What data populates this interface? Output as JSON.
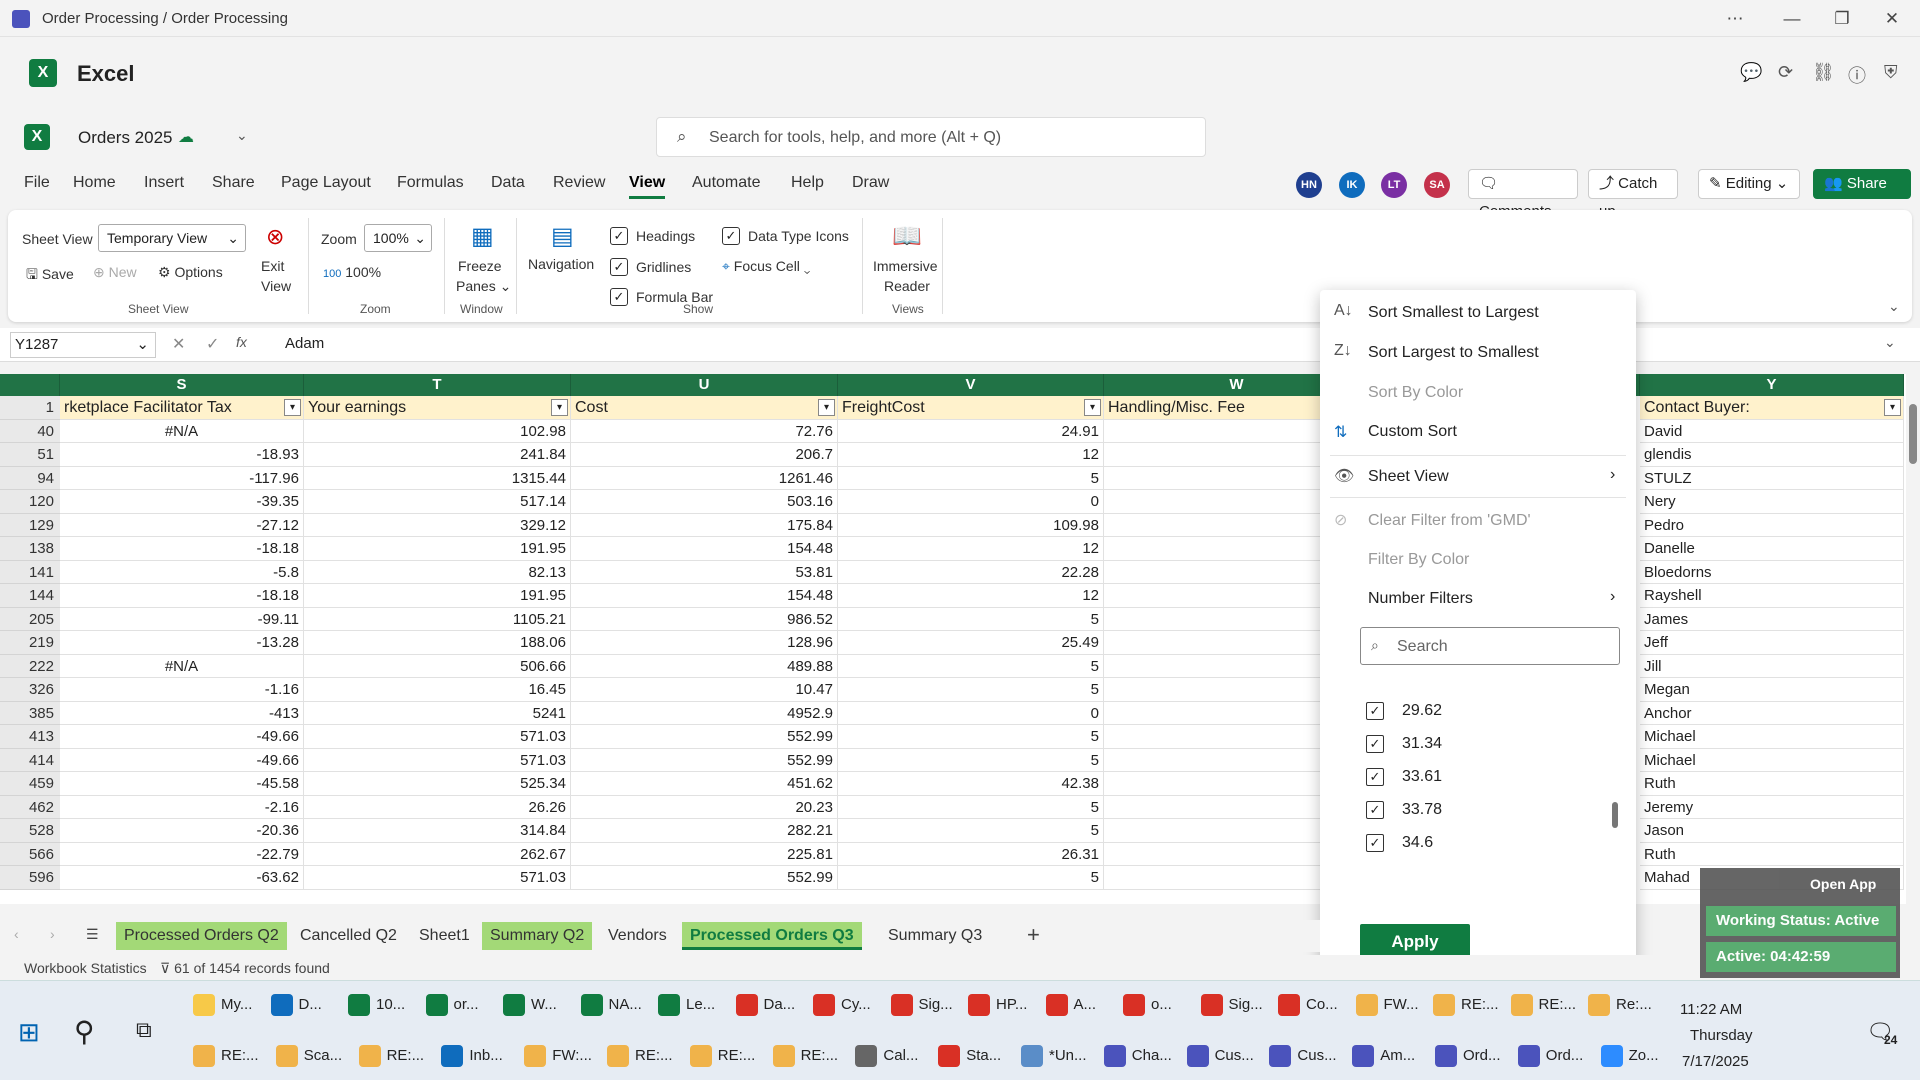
{
  "window": {
    "title": "Order Processing / Order Processing"
  },
  "app": {
    "name": "Excel",
    "doc_name": "Orders 2025"
  },
  "search": {
    "placeholder": "Search for tools, help, and more (Alt + Q)"
  },
  "menu": [
    "File",
    "Home",
    "Insert",
    "Share",
    "Page Layout",
    "Formulas",
    "Data",
    "Review",
    "View",
    "Automate",
    "Help",
    "Draw"
  ],
  "menu_active": "View",
  "avatars": [
    {
      "i": "HN",
      "c": "#1f3f8f"
    },
    {
      "i": "IK",
      "c": "#0f6cbd"
    },
    {
      "i": "LT",
      "c": "#7a2fa3"
    },
    {
      "i": "SA",
      "c": "#c4314b"
    }
  ],
  "header_btns": {
    "comments": "Comments",
    "catchup": "Catch up",
    "editing": "Editing",
    "share": "Share"
  },
  "ribbon": {
    "sheet_view_label": "Sheet View",
    "sheet_view_value": "Temporary View",
    "save": "Save",
    "new": "New",
    "options": "Options",
    "exit": "Exit",
    "exit2": "View",
    "group_sheet": "Sheet View",
    "zoom_label": "Zoom",
    "zoom_value": "100%",
    "zoom100": "100%",
    "group_zoom": "Zoom",
    "freeze": "Freeze",
    "freeze2": "Panes",
    "group_window": "Window",
    "navigation": "Navigation",
    "headings": "Headings",
    "gridlines": "Gridlines",
    "formula_bar": "Formula Bar",
    "data_type_icons": "Data Type Icons",
    "focus_cell": "Focus Cell",
    "group_show": "Show",
    "immersive": "Immersive",
    "reader": "Reader",
    "group_views": "Views"
  },
  "formula": {
    "namebox": "Y1287",
    "fx": "fx",
    "value": "Adam"
  },
  "columns": {
    "s": "S",
    "t": "T",
    "u": "U",
    "v": "V",
    "w": "W",
    "y": "Y"
  },
  "header_row": {
    "num": "1",
    "s": "rketplace Facilitator Tax",
    "t": "Your earnings",
    "u": "Cost",
    "v": "FreightCost",
    "w": "Handling/Misc. Fee",
    "y": "Contact Buyer:"
  },
  "rows": [
    {
      "r": "40",
      "s": "#N/A",
      "t": "102.98",
      "u": "72.76",
      "v": "24.91",
      "y": "David"
    },
    {
      "r": "51",
      "s": "-18.93",
      "t": "241.84",
      "u": "206.7",
      "v": "12",
      "y": "glendis"
    },
    {
      "r": "94",
      "s": "-117.96",
      "t": "1315.44",
      "u": "1261.46",
      "v": "5",
      "y": "STULZ"
    },
    {
      "r": "120",
      "s": "-39.35",
      "t": "517.14",
      "u": "503.16",
      "v": "0",
      "y": "Nery"
    },
    {
      "r": "129",
      "s": "-27.12",
      "t": "329.12",
      "u": "175.84",
      "v": "109.98",
      "y": "Pedro"
    },
    {
      "r": "138",
      "s": "-18.18",
      "t": "191.95",
      "u": "154.48",
      "v": "12",
      "y": "Danelle"
    },
    {
      "r": "141",
      "s": "-5.8",
      "t": "82.13",
      "u": "53.81",
      "v": "22.28",
      "y": "Bloedorns"
    },
    {
      "r": "144",
      "s": "-18.18",
      "t": "191.95",
      "u": "154.48",
      "v": "12",
      "y": "Rayshell"
    },
    {
      "r": "205",
      "s": "-99.11",
      "t": "1105.21",
      "u": "986.52",
      "v": "5",
      "y": "James"
    },
    {
      "r": "219",
      "s": "-13.28",
      "t": "188.06",
      "u": "128.96",
      "v": "25.49",
      "y": "Jeff"
    },
    {
      "r": "222",
      "s": "#N/A",
      "t": "506.66",
      "u": "489.88",
      "v": "5",
      "y": "Jill"
    },
    {
      "r": "326",
      "s": "-1.16",
      "t": "16.45",
      "u": "10.47",
      "v": "5",
      "y": "Megan"
    },
    {
      "r": "385",
      "s": "-413",
      "t": "5241",
      "u": "4952.9",
      "v": "0",
      "y": "Anchor"
    },
    {
      "r": "413",
      "s": "-49.66",
      "t": "571.03",
      "u": "552.99",
      "v": "5",
      "y": "Michael"
    },
    {
      "r": "414",
      "s": "-49.66",
      "t": "571.03",
      "u": "552.99",
      "v": "5",
      "y": "Michael"
    },
    {
      "r": "459",
      "s": "-45.58",
      "t": "525.34",
      "u": "451.62",
      "v": "42.38",
      "y": "Ruth"
    },
    {
      "r": "462",
      "s": "-2.16",
      "t": "26.26",
      "u": "20.23",
      "v": "5",
      "y": "Jeremy"
    },
    {
      "r": "528",
      "s": "-20.36",
      "t": "314.84",
      "u": "282.21",
      "v": "5",
      "y": "Jason"
    },
    {
      "r": "566",
      "s": "-22.79",
      "t": "262.67",
      "u": "225.81",
      "v": "26.31",
      "y": "Ruth"
    },
    {
      "r": "596",
      "s": "-63.62",
      "t": "571.03",
      "u": "552.99",
      "v": "5",
      "y": "Mahad"
    }
  ],
  "popup": {
    "sort_asc": "Sort Smallest to Largest",
    "sort_desc": "Sort Largest to Smallest",
    "sort_color": "Sort By Color",
    "custom_sort": "Custom Sort",
    "sheet_view": "Sheet View",
    "clear_filter": "Clear Filter from 'GMD'",
    "filter_color": "Filter By Color",
    "number_filters": "Number Filters",
    "search_placeholder": "Search",
    "values": [
      "29.62",
      "31.34",
      "33.61",
      "33.78",
      "34.6"
    ],
    "apply": "Apply"
  },
  "sheet_tabs": [
    {
      "n": "Processed Orders Q2",
      "g": true
    },
    {
      "n": "Cancelled Q2",
      "g": false
    },
    {
      "n": "Sheet1",
      "g": false
    },
    {
      "n": "Summary Q2",
      "g": true
    },
    {
      "n": "Vendors",
      "g": false
    },
    {
      "n": "Processed Orders Q3",
      "g": true,
      "a": true
    },
    {
      "n": "Summary Q3",
      "g": false
    }
  ],
  "status": {
    "stats": "Workbook Statistics",
    "records": "61 of 1454 records found"
  },
  "overlay": {
    "open": "Open App",
    "working": "Working Status: Active",
    "active": "Active: 04:42:59"
  },
  "taskbar": {
    "row1": [
      "My...",
      "D...",
      "10...",
      "or...",
      "W...",
      "NA...",
      "Le...",
      "Da...",
      "Cy...",
      "Sig...",
      "HP...",
      "A...",
      "o...",
      "Sig...",
      "Co...",
      "FW...",
      "RE:...",
      "RE:...",
      "Re:..."
    ],
    "row2": [
      "RE:...",
      "Sca...",
      "RE:...",
      "Inb...",
      "FW:...",
      "RE:...",
      "RE:...",
      "RE:...",
      "Cal...",
      "Sta...",
      "*Un...",
      "Cha...",
      "Cus...",
      "Cus...",
      "Am...",
      "Ord...",
      "Ord...",
      "Zo..."
    ],
    "time": "11:22 AM",
    "day": "Thursday",
    "date": "7/17/2025",
    "badge": "24"
  }
}
